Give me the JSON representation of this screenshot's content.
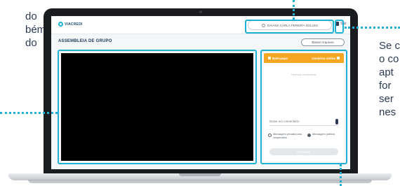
{
  "captions": {
    "left_lines": [
      "do",
      "bém",
      "",
      "do"
    ],
    "right_lines": [
      "Se c",
      "o co",
      "apt",
      "for",
      "ser",
      "nes"
    ]
  },
  "app": {
    "logo": "VIACREDI",
    "user_name": "DAIANA CARLA PEREIRA SOLLES",
    "exit_label": "Sair",
    "page_title": "ASSEMBLEIA DE GRUPO",
    "files_button": "Baixar Arquivos"
  },
  "chat": {
    "tabs": [
      "Bate-papo",
      "Usuários online"
    ],
    "empty_message": "Nenhum comentário",
    "input_placeholder": "Deixe um comentário",
    "radio_options": [
      "Mensagem privada para cooperativa",
      "Mensagem pública"
    ],
    "selected_radio": 1,
    "send_button": "Comentar"
  },
  "colors": {
    "accent": "#1fb0d6",
    "chat_header": "#f5a623",
    "video_bg": "#000000",
    "laptop_frame": "#1b1c20"
  }
}
